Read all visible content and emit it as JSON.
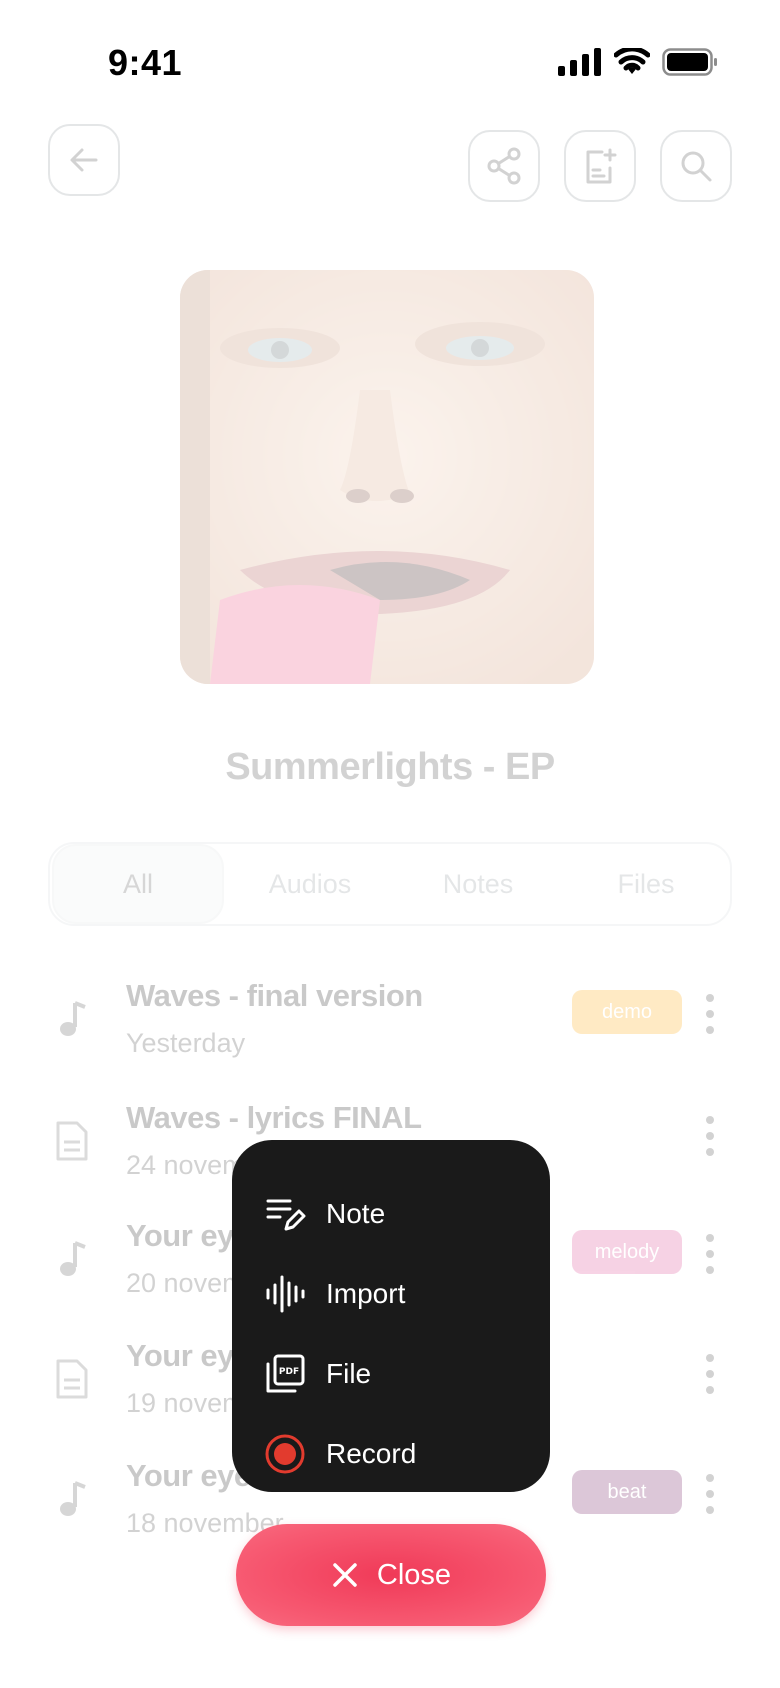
{
  "status_bar": {
    "time": "9:41"
  },
  "header": {
    "back_icon": "arrow-left-icon",
    "share_icon": "share-icon",
    "export_icon": "document-add-icon",
    "search_icon": "search-icon"
  },
  "album": {
    "title": "Summerlights - EP",
    "cover": "face-portrait-image"
  },
  "tabs": [
    {
      "label": "All",
      "active": true
    },
    {
      "label": "Audios",
      "active": false
    },
    {
      "label": "Notes",
      "active": false
    },
    {
      "label": "Files",
      "active": false
    }
  ],
  "items": [
    {
      "icon": "music-note-icon",
      "title": "Waves - final version",
      "date": "Yesterday",
      "tag": "demo",
      "tag_color": "#ffb020"
    },
    {
      "icon": "document-icon",
      "title": "Waves - lyrics FINAL",
      "date": "24 november",
      "tag": "",
      "tag_color": ""
    },
    {
      "icon": "music-note-icon",
      "title": "Your eye",
      "date": "20 novem",
      "tag": "melody",
      "tag_color": "#e0559a"
    },
    {
      "icon": "document-icon",
      "title": "Your eye",
      "date": "19 novem",
      "tag": "",
      "tag_color": ""
    },
    {
      "icon": "music-note-icon",
      "title": "Your eye",
      "date": "18 november",
      "tag": "beat",
      "tag_color": "#7b2a6a"
    }
  ],
  "menu": {
    "note_label": "Note",
    "import_label": "Import",
    "file_label": "File",
    "record_label": "Record"
  },
  "close_button": {
    "label": "Close"
  },
  "colors": {
    "accent": "#f03a58",
    "menu_bg": "#1a1a1a",
    "record": "#e23b2e"
  }
}
